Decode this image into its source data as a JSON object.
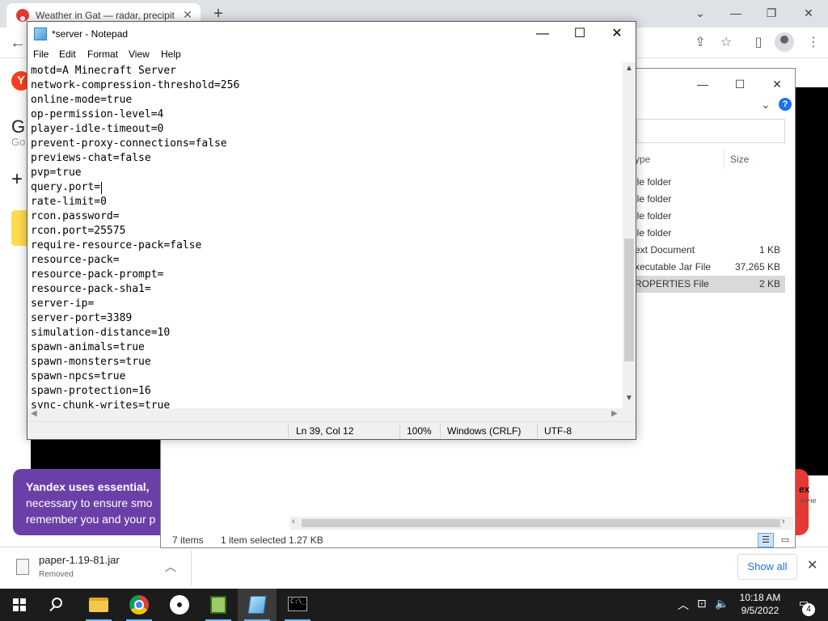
{
  "browser": {
    "tab_title": "Weather in Gat — radar, precipit",
    "tab_close": "✕",
    "new_tab": "+",
    "window_min": "⌄",
    "window_minimize": "—",
    "window_restore": "❐",
    "window_close": "✕",
    "back": "←",
    "yandex_logo": "Y",
    "page_heading_letter": "G",
    "page_sub_letter": "Go",
    "plus": "+",
    "cookie": {
      "title": "Yandex uses essential,",
      "line1": "necessary to ensure smo",
      "line2": "remember you and your p"
    },
    "ex_text": "ex",
    "ex_sub": "вёче",
    "accent_color": "#6b3fa8"
  },
  "download_bar": {
    "file_name": "paper-1.19-81.jar",
    "status": "Removed",
    "show_all": "Show all",
    "close": "✕"
  },
  "explorer": {
    "col_type": "ype",
    "col_size": "Size",
    "rows": [
      {
        "type": "ile folder",
        "size": ""
      },
      {
        "type": "ile folder",
        "size": ""
      },
      {
        "type": "ile folder",
        "size": ""
      },
      {
        "type": "ile folder",
        "size": ""
      },
      {
        "type": "ext Document",
        "size": "1 KB"
      },
      {
        "type": "xecutable Jar File",
        "size": "37,265 KB"
      },
      {
        "type": "ROPERTIES File",
        "size": "2 KB"
      }
    ],
    "selected_row": 6,
    "status_items": "7 items",
    "status_selected": "1 item selected",
    "status_size": "1.27 KB"
  },
  "notepad": {
    "title": "*server - Notepad",
    "menu": [
      "File",
      "Edit",
      "Format",
      "View",
      "Help"
    ],
    "lines": [
      "motd=A Minecraft Server",
      "network-compression-threshold=256",
      "online-mode=true",
      "op-permission-level=4",
      "player-idle-timeout=0",
      "prevent-proxy-connections=false",
      "previews-chat=false",
      "pvp=true",
      "query.port=",
      "rate-limit=0",
      "rcon.password=",
      "rcon.port=25575",
      "require-resource-pack=false",
      "resource-pack=",
      "resource-pack-prompt=",
      "resource-pack-sha1=",
      "server-ip=",
      "server-port=3389",
      "simulation-distance=10",
      "spawn-animals=true",
      "spawn-monsters=true",
      "spawn-npcs=true",
      "spawn-protection=16",
      "sync-chunk-writes=true"
    ],
    "caret_line": 8,
    "status": {
      "position": "Ln 39, Col 12",
      "zoom": "100%",
      "line_ending": "Windows (CRLF)",
      "encoding": "UTF-8"
    }
  },
  "taskbar": {
    "apps": [
      "start-icon",
      "search-icon",
      "file-explorer-icon",
      "chrome-icon",
      "obs-icon",
      "spreadsheet-icon",
      "notepad-icon",
      "cmd-icon"
    ],
    "time": "10:18 AM",
    "date": "9/5/2022",
    "notifications": "4"
  }
}
